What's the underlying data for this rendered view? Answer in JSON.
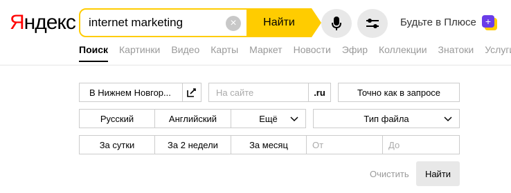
{
  "header": {
    "logo_first": "Я",
    "logo_rest": "ндекс",
    "search_value": "internet marketing",
    "find_label": "Найти",
    "plus_label": "Будьте в Плюсе",
    "plus_badge": "+"
  },
  "tabs": [
    {
      "label": "Поиск",
      "active": true
    },
    {
      "label": "Картинки"
    },
    {
      "label": "Видео"
    },
    {
      "label": "Карты"
    },
    {
      "label": "Маркет"
    },
    {
      "label": "Новости"
    },
    {
      "label": "Эфир"
    },
    {
      "label": "Коллекции"
    },
    {
      "label": "Знатоки"
    },
    {
      "label": "Услуги"
    }
  ],
  "advanced": {
    "region": "В Нижнем Новгор...",
    "site_placeholder": "На сайте",
    "domain": ".ru",
    "exact": "Точно как в запросе",
    "lang_russian": "Русский",
    "lang_english": "Английский",
    "lang_more": "Ещё",
    "filetype": "Тип файла",
    "period_day": "За сутки",
    "period_2weeks": "За 2 недели",
    "period_month": "За месяц",
    "from_placeholder": "От",
    "to_placeholder": "До",
    "clear_label": "Очистить",
    "find_label": "Найти"
  },
  "colors": {
    "accent": "#ffcc00",
    "logo_red": "#ff0000",
    "plus_purple": "#6a3de8"
  }
}
